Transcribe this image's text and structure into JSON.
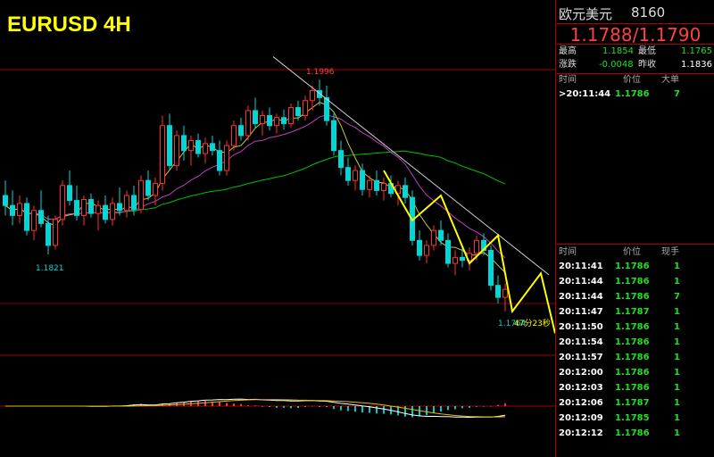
{
  "title": "EURUSD 4H",
  "quote": {
    "name": "欧元美元",
    "code": "8160",
    "bid_ask": "1.1788/1.1790",
    "high_label": "最高",
    "high": "1.1854",
    "low_label": "最低",
    "low": "1.1765",
    "change_label": "涨跌",
    "change": "-0.0048",
    "prev_close_label": "昨收",
    "prev_close": "1.1836"
  },
  "big_orders": {
    "headers": [
      "时间",
      "价位",
      "大单"
    ],
    "rows": [
      {
        "time": ">20:11:44",
        "price": "1.1786",
        "size": "7"
      }
    ]
  },
  "ticks": {
    "headers": [
      "时间",
      "价位",
      "现手"
    ],
    "rows": [
      {
        "time": "20:11:41",
        "price": "1.1786",
        "size": "1"
      },
      {
        "time": "20:11:44",
        "price": "1.1786",
        "size": "1"
      },
      {
        "time": "20:11:44",
        "price": "1.1786",
        "size": "7"
      },
      {
        "time": "20:11:47",
        "price": "1.1787",
        "size": "1"
      },
      {
        "time": "20:11:50",
        "price": "1.1786",
        "size": "1"
      },
      {
        "time": "20:11:54",
        "price": "1.1786",
        "size": "1"
      },
      {
        "time": "20:11:57",
        "price": "1.1786",
        "size": "1"
      },
      {
        "time": "20:12:00",
        "price": "1.1786",
        "size": "1"
      },
      {
        "time": "20:12:03",
        "price": "1.1786",
        "size": "1"
      },
      {
        "time": "20:12:06",
        "price": "1.1787",
        "size": "1"
      },
      {
        "time": "20:12:09",
        "price": "1.1785",
        "size": "1"
      },
      {
        "time": "20:12:12",
        "price": "1.1786",
        "size": "1"
      }
    ]
  },
  "chart_data": {
    "type": "candlestick",
    "title": "EURUSD 4H",
    "price_labels": {
      "high": "1.1996",
      "low": "1.1821",
      "last": "1.1764",
      "timer": "47分23秒"
    },
    "ylim": [
      1.172,
      1.204
    ],
    "candles": [
      [
        1.188,
        1.1895,
        1.186,
        1.187
      ],
      [
        1.187,
        1.1885,
        1.185,
        1.186
      ],
      [
        1.186,
        1.188,
        1.1852,
        1.1872
      ],
      [
        1.1872,
        1.1878,
        1.184,
        1.1845
      ],
      [
        1.1845,
        1.187,
        1.1835,
        1.1865
      ],
      [
        1.1865,
        1.1885,
        1.1848,
        1.1852
      ],
      [
        1.1852,
        1.186,
        1.1821,
        1.183
      ],
      [
        1.183,
        1.186,
        1.1826,
        1.1856
      ],
      [
        1.1856,
        1.1895,
        1.185,
        1.189
      ],
      [
        1.189,
        1.1905,
        1.187,
        1.1875
      ],
      [
        1.1875,
        1.189,
        1.1855,
        1.186
      ],
      [
        1.186,
        1.188,
        1.185,
        1.1876
      ],
      [
        1.1876,
        1.1882,
        1.1858,
        1.1862
      ],
      [
        1.1862,
        1.1875,
        1.1845,
        1.187
      ],
      [
        1.187,
        1.188,
        1.1852,
        1.1856
      ],
      [
        1.1856,
        1.1878,
        1.185,
        1.1872
      ],
      [
        1.1872,
        1.1888,
        1.186,
        1.1865
      ],
      [
        1.1865,
        1.1885,
        1.1858,
        1.188
      ],
      [
        1.188,
        1.189,
        1.186,
        1.1866
      ],
      [
        1.1866,
        1.19,
        1.1862,
        1.1895
      ],
      [
        1.1895,
        1.1905,
        1.1875,
        1.188
      ],
      [
        1.188,
        1.1898,
        1.187,
        1.1892
      ],
      [
        1.1892,
        1.196,
        1.1885,
        1.195
      ],
      [
        1.195,
        1.1962,
        1.1905,
        1.191
      ],
      [
        1.191,
        1.1945,
        1.1905,
        1.194
      ],
      [
        1.194,
        1.195,
        1.1915,
        1.1925
      ],
      [
        1.1925,
        1.194,
        1.191,
        1.1935
      ],
      [
        1.1935,
        1.1942,
        1.1918,
        1.1922
      ],
      [
        1.1922,
        1.1938,
        1.1912,
        1.1932
      ],
      [
        1.1932,
        1.194,
        1.192,
        1.1925
      ],
      [
        1.1925,
        1.1935,
        1.19,
        1.1905
      ],
      [
        1.1905,
        1.1935,
        1.19,
        1.193
      ],
      [
        1.193,
        1.1955,
        1.1925,
        1.195
      ],
      [
        1.195,
        1.1958,
        1.1935,
        1.194
      ],
      [
        1.194,
        1.197,
        1.1935,
        1.1965
      ],
      [
        1.1965,
        1.1978,
        1.1948,
        1.1952
      ],
      [
        1.1952,
        1.1965,
        1.194,
        1.196
      ],
      [
        1.196,
        1.1968,
        1.1945,
        1.195
      ],
      [
        1.195,
        1.1962,
        1.1942,
        1.1958
      ],
      [
        1.1958,
        1.1966,
        1.1946,
        1.1952
      ],
      [
        1.1952,
        1.1972,
        1.1948,
        1.1968
      ],
      [
        1.1968,
        1.1975,
        1.1955,
        1.196
      ],
      [
        1.196,
        1.198,
        1.1955,
        1.1975
      ],
      [
        1.1975,
        1.199,
        1.1965,
        1.1985
      ],
      [
        1.1985,
        1.1996,
        1.197,
        1.1978
      ],
      [
        1.1978,
        1.199,
        1.195,
        1.1955
      ],
      [
        1.1955,
        1.1962,
        1.192,
        1.1925
      ],
      [
        1.1925,
        1.1935,
        1.19,
        1.1908
      ],
      [
        1.1908,
        1.1918,
        1.189,
        1.1895
      ],
      [
        1.1895,
        1.191,
        1.1885,
        1.1905
      ],
      [
        1.1905,
        1.1912,
        1.188,
        1.1886
      ],
      [
        1.1886,
        1.19,
        1.1878,
        1.1895
      ],
      [
        1.1895,
        1.1905,
        1.188,
        1.1885
      ],
      [
        1.1885,
        1.1898,
        1.1875,
        1.1892
      ],
      [
        1.1892,
        1.19,
        1.1878,
        1.1882
      ],
      [
        1.1882,
        1.1895,
        1.187,
        1.189
      ],
      [
        1.189,
        1.1898,
        1.1872,
        1.1878
      ],
      [
        1.1878,
        1.1885,
        1.183,
        1.1835
      ],
      [
        1.1835,
        1.1845,
        1.1815,
        1.182
      ],
      [
        1.182,
        1.1835,
        1.1812,
        1.183
      ],
      [
        1.183,
        1.185,
        1.1825,
        1.1845
      ],
      [
        1.1845,
        1.1855,
        1.183,
        1.1835
      ],
      [
        1.1835,
        1.1842,
        1.1808,
        1.1812
      ],
      [
        1.1812,
        1.1825,
        1.18,
        1.1818
      ],
      [
        1.1818,
        1.183,
        1.1808,
        1.1815
      ],
      [
        1.1815,
        1.1828,
        1.1805,
        1.1822
      ],
      [
        1.1822,
        1.184,
        1.1815,
        1.1835
      ],
      [
        1.1835,
        1.1842,
        1.182,
        1.1825
      ],
      [
        1.1825,
        1.183,
        1.1785,
        1.179
      ],
      [
        1.179,
        1.18,
        1.1772,
        1.1778
      ],
      [
        1.1778,
        1.1792,
        1.1764,
        1.1786
      ]
    ],
    "trendline": {
      "from": {
        "i": 40,
        "price": 1.201
      },
      "to": {
        "i": 78,
        "price": 1.179
      }
    },
    "wave_projection": [
      1.1905,
      1.1855,
      1.188,
      1.1812,
      1.184,
      1.1764,
      1.1802,
      1.1742
    ]
  }
}
